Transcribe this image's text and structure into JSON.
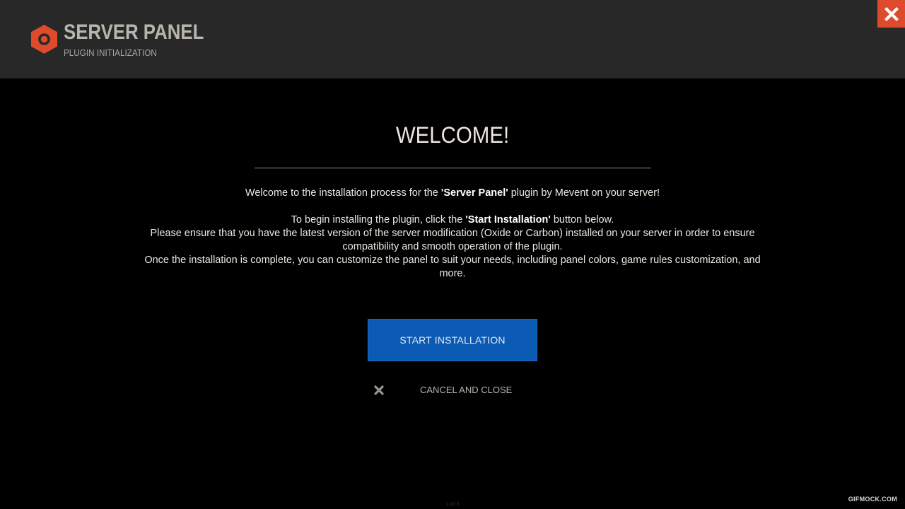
{
  "header": {
    "title": "SERVER PANEL",
    "subtitle": "PLUGIN INITIALIZATION",
    "logo_icon": "hexagon-logo-icon",
    "close_icon": "close-icon"
  },
  "welcome": {
    "title": "WELCOME!",
    "intro_before": "Welcome to the installation process for the ",
    "intro_bold": "'Server Panel'",
    "intro_after": " plugin by Mevent on your server!",
    "instruct_before": "To begin installing the plugin, click the ",
    "instruct_bold": "'Start Installation'",
    "instruct_after": " button below.",
    "ensure_text": "Please ensure that you have the latest version of the server modification (Oxide or Carbon) installed on your server in order to ensure compatibility and smooth operation of the plugin.",
    "complete_text": "Once the installation is complete, you can customize the panel to suit your needs, including panel colors, game rules customization, and more."
  },
  "actions": {
    "start_label": "START INSTALLATION",
    "cancel_label": "CANCEL AND CLOSE",
    "cancel_icon": "x-icon"
  },
  "footer": {
    "version": "1.0.0.0",
    "watermark": "GIFMOCK.COM"
  },
  "colors": {
    "accent": "#dd4a2c",
    "primary_button": "#0b5bb5",
    "header_bg": "#282828",
    "page_bg": "#000000"
  }
}
